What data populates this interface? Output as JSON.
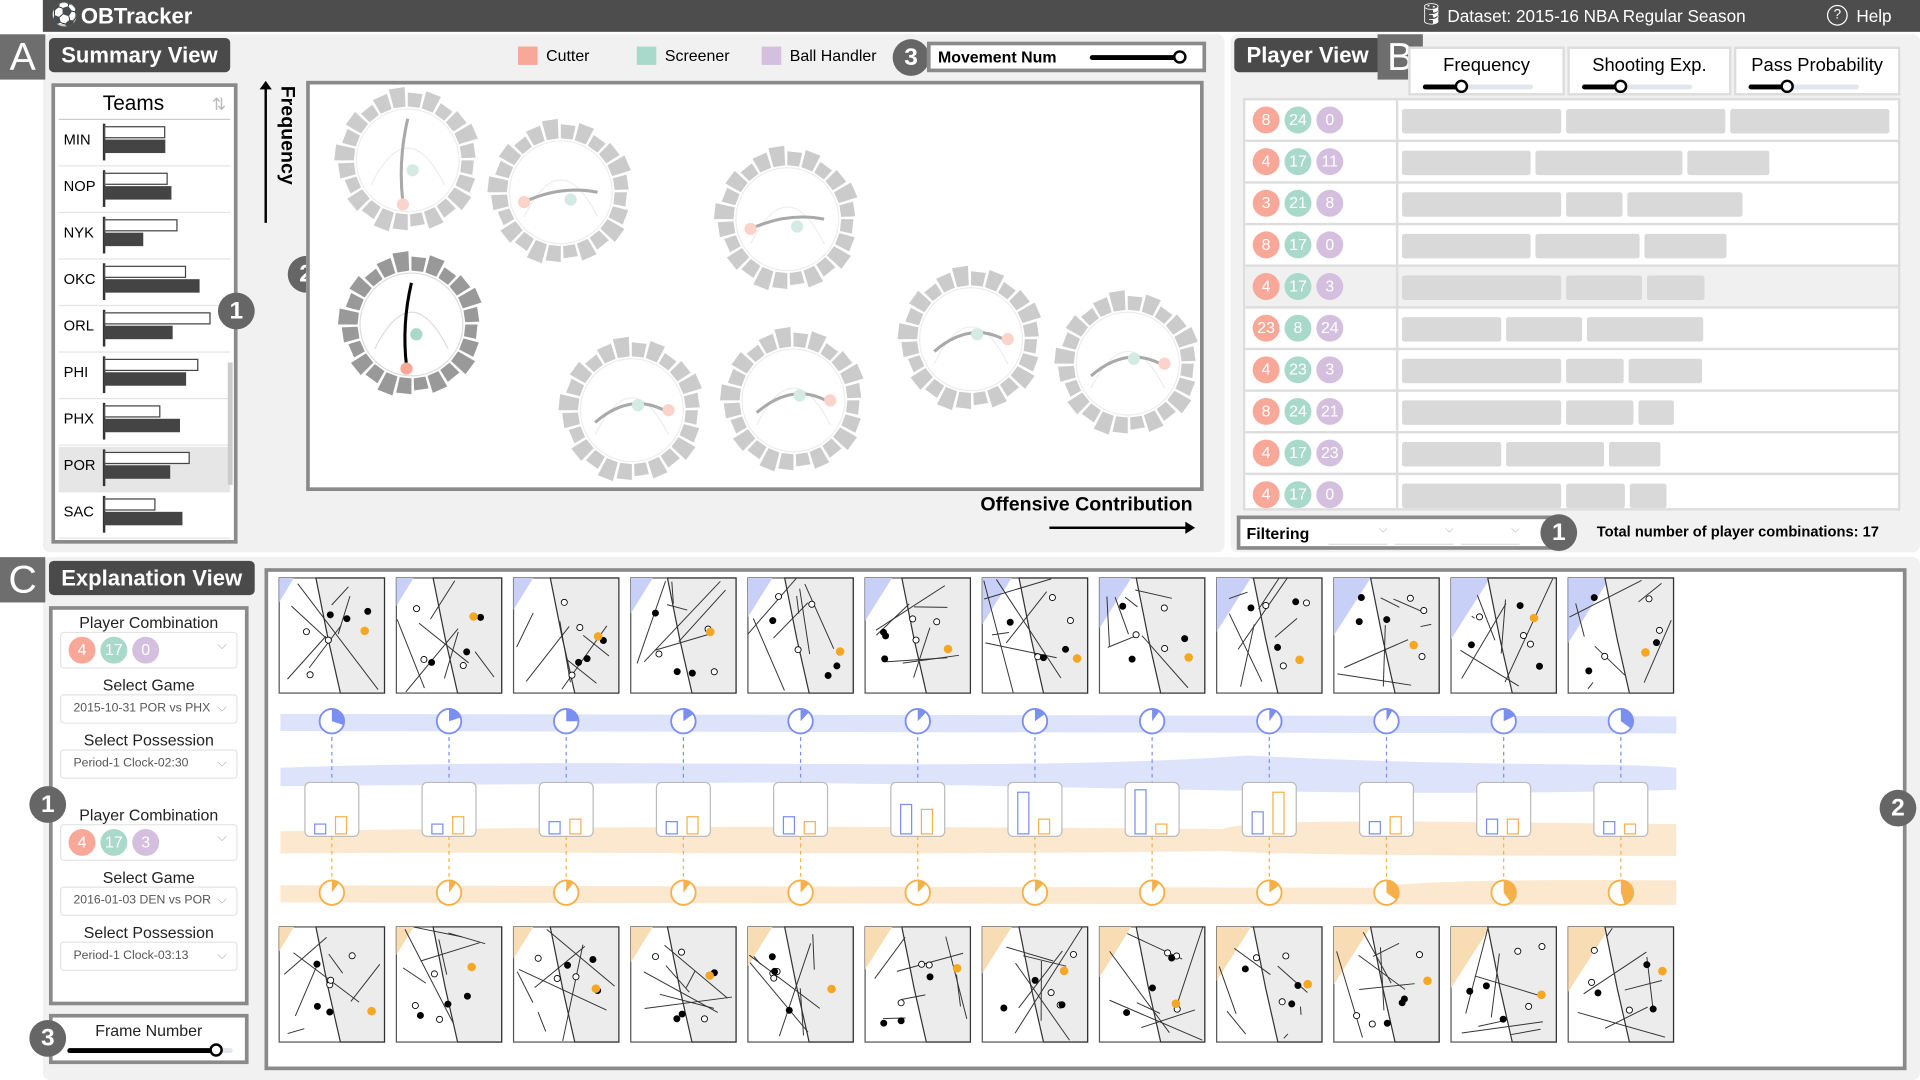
{
  "app": {
    "title": "OBTracker",
    "logo_icon": "basketball-icon",
    "dataset_icon": "database-icon",
    "dataset": "Dataset: 2015-16 NBA Regular Season",
    "help_icon": "help-icon",
    "help": "Help"
  },
  "summary": {
    "letter": "A",
    "title": "Summary View",
    "legend": [
      {
        "label": "Cutter",
        "color": "#f7a898"
      },
      {
        "label": "Screener",
        "color": "#a9d9ca"
      },
      {
        "label": "Ball Handler",
        "color": "#d5bfdf"
      }
    ],
    "movement": {
      "badge": "3",
      "label": "Movement Num",
      "value": 0.93
    },
    "teams": {
      "title": "Teams",
      "sort_icon": "sort-icon",
      "badge": "1",
      "rows": [
        {
          "name": "MIN",
          "a": 0.56,
          "b": 0.56
        },
        {
          "name": "NOP",
          "a": 0.58,
          "b": 0.61
        },
        {
          "name": "NYK",
          "a": 0.67,
          "b": 0.36
        },
        {
          "name": "OKC",
          "a": 0.74,
          "b": 0.87
        },
        {
          "name": "ORL",
          "a": 0.97,
          "b": 0.62
        },
        {
          "name": "PHI",
          "a": 0.86,
          "b": 0.74
        },
        {
          "name": "PHX",
          "a": 0.51,
          "b": 0.69
        },
        {
          "name": "POR",
          "a": 0.78,
          "b": 0.6,
          "selected": true
        },
        {
          "name": "SAC",
          "a": 0.47,
          "b": 0.71
        }
      ]
    },
    "glyph_badge": "2",
    "ylabel": "Frequency",
    "xlabel": "Offensive Contribution"
  },
  "player": {
    "letter": "B",
    "title": "Player View",
    "columns": [
      {
        "label": "Frequency",
        "value": 0.35
      },
      {
        "label": "Shooting Exp.",
        "value": 0.35
      },
      {
        "label": "Pass Probability",
        "value": 0.35
      }
    ],
    "rows": [
      {
        "combo": [
          "8",
          "24",
          "0"
        ],
        "bars": [
          1,
          1,
          1
        ]
      },
      {
        "combo": [
          "4",
          "17",
          "11"
        ],
        "bars": [
          0.81,
          0.92,
          0.52
        ]
      },
      {
        "combo": [
          "3",
          "21",
          "8"
        ],
        "bars": [
          1,
          0.35,
          0.73
        ]
      },
      {
        "combo": [
          "8",
          "17",
          "0"
        ],
        "bars": [
          0.81,
          0.65,
          0.52
        ]
      },
      {
        "combo": [
          "4",
          "17",
          "3"
        ],
        "bars": [
          1,
          0.48,
          0.36
        ],
        "selected": true
      },
      {
        "combo": [
          "23",
          "8",
          "24"
        ],
        "bars": [
          0.62,
          0.48,
          0.73
        ]
      },
      {
        "combo": [
          "4",
          "23",
          "3"
        ],
        "bars": [
          1,
          0.36,
          0.46
        ]
      },
      {
        "combo": [
          "8",
          "24",
          "21"
        ],
        "bars": [
          1,
          0.42,
          0.23
        ]
      },
      {
        "combo": [
          "4",
          "17",
          "23"
        ],
        "bars": [
          0.62,
          0.62,
          0.32
        ]
      },
      {
        "combo": [
          "4",
          "17",
          "0"
        ],
        "bars": [
          1,
          0.37,
          0.23
        ]
      }
    ],
    "filter_label": "Filtering",
    "filter_badge": "1",
    "total": "Total number of player combinations: 17"
  },
  "explanation": {
    "letter": "C",
    "title": "Explanation View",
    "badge_left": "1",
    "badge_right": "2",
    "groups": [
      {
        "combo_label": "Player Combination",
        "combo": [
          "4",
          "17",
          "0"
        ],
        "game_label": "Select Game",
        "game": "2015-10-31 POR vs PHX",
        "poss_label": "Select Possession",
        "poss": "Period-1 Clock-02:30"
      },
      {
        "combo_label": "Player Combination",
        "combo": [
          "4",
          "17",
          "3"
        ],
        "game_label": "Select Game",
        "game": "2016-01-03 DEN vs POR",
        "poss_label": "Select Possession",
        "poss": "Period-1 Clock-03:13"
      }
    ],
    "frame": {
      "badge": "3",
      "label": "Frame Number",
      "value": 0.9
    },
    "colors": {
      "blue": "#7b8ff0",
      "orange": "#f5b04a"
    },
    "blue_pie": [
      0.3,
      0.2,
      0.25,
      0.15,
      0.12,
      0.12,
      0.15,
      0.1,
      0.1,
      0.08,
      0.18,
      0.35
    ],
    "orange_pie": [
      0.1,
      0.1,
      0.1,
      0.1,
      0.12,
      0.12,
      0.12,
      0.1,
      0.15,
      0.35,
      0.4,
      0.45
    ],
    "blue_bars": [
      0.2,
      0.2,
      0.25,
      0.25,
      0.35,
      0.6,
      0.85,
      0.9,
      0.45,
      0.25,
      0.3,
      0.25
    ],
    "orange_bars": [
      0.35,
      0.35,
      0.3,
      0.35,
      0.25,
      0.5,
      0.3,
      0.2,
      0.85,
      0.35,
      0.3,
      0.2
    ]
  }
}
